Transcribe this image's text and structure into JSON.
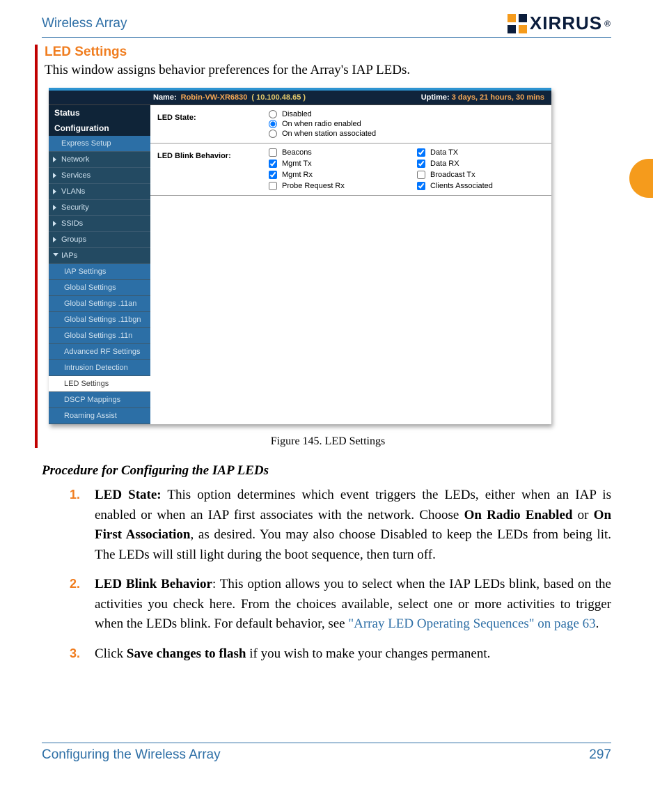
{
  "header": {
    "title": "Wireless Array",
    "logo_text": "XIRRUS",
    "logo_reg": "®"
  },
  "section": {
    "heading": "LED Settings"
  },
  "intro": "This window assigns behavior preferences for the Array's IAP LEDs.",
  "screenshot": {
    "name_label": "Name:",
    "name_value": "Robin-VW-XR6830",
    "name_ip": "( 10.100.48.65 )",
    "uptime_label": "Uptime:",
    "uptime_value": "3 days, 21 hours, 30 mins",
    "sidebar": {
      "status": "Status",
      "configuration": "Configuration",
      "items": [
        "Express Setup",
        "Network",
        "Services",
        "VLANs",
        "Security",
        "SSIDs",
        "Groups",
        "IAPs"
      ],
      "iap_children": [
        "IAP Settings",
        "Global Settings",
        "Global Settings .11an",
        "Global Settings .11bgn",
        "Global Settings .11n",
        "Advanced RF Settings",
        "Intrusion Detection",
        "LED Settings",
        "DSCP Mappings",
        "Roaming Assist"
      ]
    },
    "led_state": {
      "label": "LED State:",
      "options": [
        "Disabled",
        "On when radio enabled",
        "On when station associated"
      ],
      "selected_index": 1
    },
    "led_blink": {
      "label": "LED Blink Behavior:",
      "left": [
        {
          "label": "Beacons",
          "checked": false
        },
        {
          "label": "Mgmt Tx",
          "checked": true
        },
        {
          "label": "Mgmt Rx",
          "checked": true
        },
        {
          "label": "Probe Request Rx",
          "checked": false
        }
      ],
      "right": [
        {
          "label": "Data TX",
          "checked": true
        },
        {
          "label": "Data RX",
          "checked": true
        },
        {
          "label": "Broadcast Tx",
          "checked": false
        },
        {
          "label": "Clients Associated",
          "checked": true
        }
      ]
    }
  },
  "figure_caption": "Figure 145. LED Settings",
  "procedure": {
    "heading": "Procedure for Configuring the IAP LEDs",
    "items": [
      {
        "num": "1.",
        "lead": "LED State:",
        "rest1": " This option determines which event triggers the LEDs, either when an IAP is enabled or when an IAP first associates with the network. Choose ",
        "b1": "On Radio Enabled",
        "mid": " or ",
        "b2": "On First Association",
        "rest2": ", as desired. You may also choose Disabled to keep the LEDs from being lit. The LEDs will still light during the boot sequence, then turn off."
      },
      {
        "num": "2.",
        "lead": "LED Blink Behavior",
        "rest1": ": This option allows you to select when the IAP LEDs blink, based on the activities you check here. From the choices available, select one or more activities to trigger when the LEDs blink. For default behavior, see ",
        "link_text": "\"Array LED Operating Sequences\" on page 63",
        "after_link": "."
      },
      {
        "num": "3.",
        "pre": "Click ",
        "b1": "Save changes to flash",
        "rest2": " if you wish to make your changes permanent."
      }
    ]
  },
  "footer": {
    "left": "Configuring the Wireless Array",
    "right": "297"
  }
}
